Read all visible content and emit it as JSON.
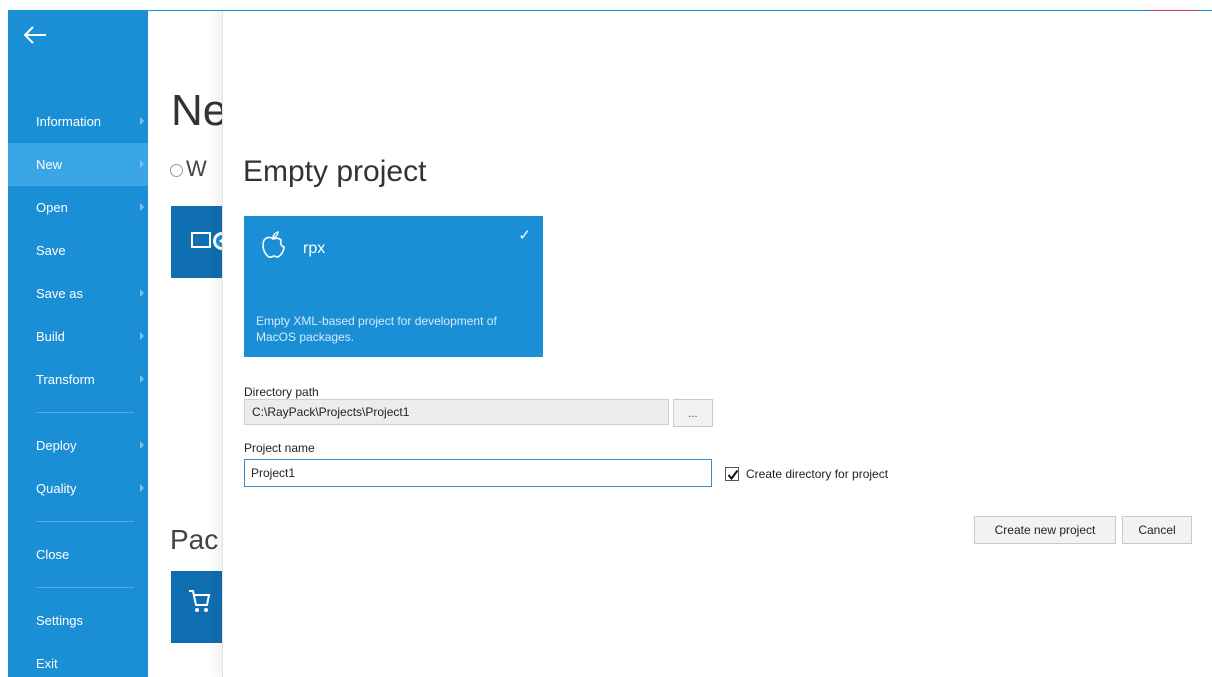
{
  "window": {
    "min_glyph": "_",
    "close_glyph": "✕"
  },
  "sidebar": {
    "back_icon": "back-arrow-icon",
    "items": [
      {
        "label": "Information",
        "has_caret": true
      },
      {
        "label": "New",
        "has_caret": true,
        "active": true
      },
      {
        "label": "Open",
        "has_caret": true
      },
      {
        "label": "Save",
        "has_caret": false
      },
      {
        "label": "Save as",
        "has_caret": true
      },
      {
        "label": "Build",
        "has_caret": true
      },
      {
        "label": "Transform",
        "has_caret": true
      },
      {
        "label": "Deploy",
        "has_caret": true
      },
      {
        "label": "Quality",
        "has_caret": true
      },
      {
        "label": "Close",
        "has_caret": false
      },
      {
        "label": "Settings",
        "has_caret": false
      },
      {
        "label": "Exit",
        "has_caret": false
      }
    ]
  },
  "background": {
    "title": "New",
    "radio_letter": "W",
    "section_partial": "Pac"
  },
  "panel": {
    "title": "Empty project",
    "template": {
      "name": "rpx",
      "check": "✓",
      "description": "Empty XML-based project for development of MacOS packages."
    },
    "directory_label": "Directory path",
    "directory_value": "C:\\RayPack\\Projects\\Project1",
    "browse_label": "...",
    "project_name_label": "Project name",
    "project_name_value": "Project1",
    "create_dir_label": "Create directory for project",
    "create_dir_checked": true,
    "create_button": "Create new project",
    "cancel_button": "Cancel"
  },
  "colors": {
    "sidebar": "#1b8fd6",
    "sidebar_active": "#3aa6e6",
    "card": "#1b8fd6",
    "close": "#c7414e"
  }
}
